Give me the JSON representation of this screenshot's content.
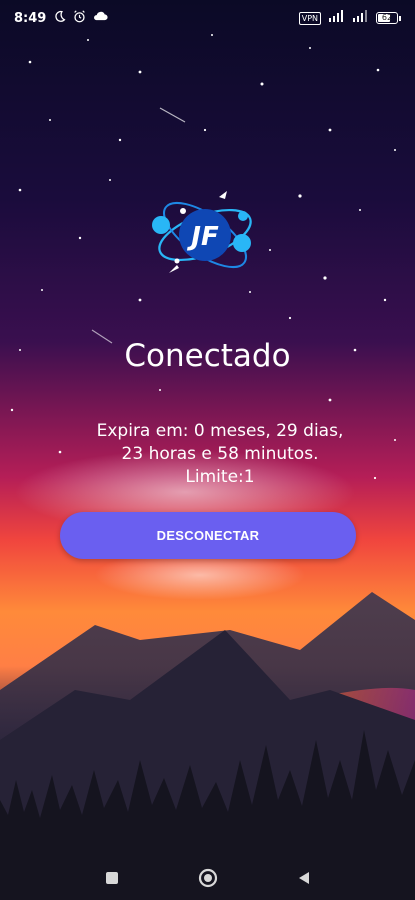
{
  "status_bar": {
    "time": "8:49",
    "icons_left": [
      "moon-icon",
      "alarm-icon",
      "cloud-icon"
    ],
    "icons_right": [
      "vpn-icon",
      "data-signal-icon",
      "signal-icon",
      "battery-icon"
    ],
    "vpn_label": "VPN",
    "battery_level": "62"
  },
  "app": {
    "logo_text": "JF",
    "status_title": "Conectado",
    "expiry_line1": "Expira em: 0 meses, 29 dias,",
    "expiry_line2": "23 horas e 58 minutos.",
    "limit_text": "Limite:1",
    "disconnect_label": "DESCONECTAR"
  },
  "nav_bar": {
    "items": [
      "recents-button",
      "home-button",
      "back-button"
    ]
  },
  "colors": {
    "button": "#6a5ff0",
    "logo_blue": "#29b6f6"
  }
}
